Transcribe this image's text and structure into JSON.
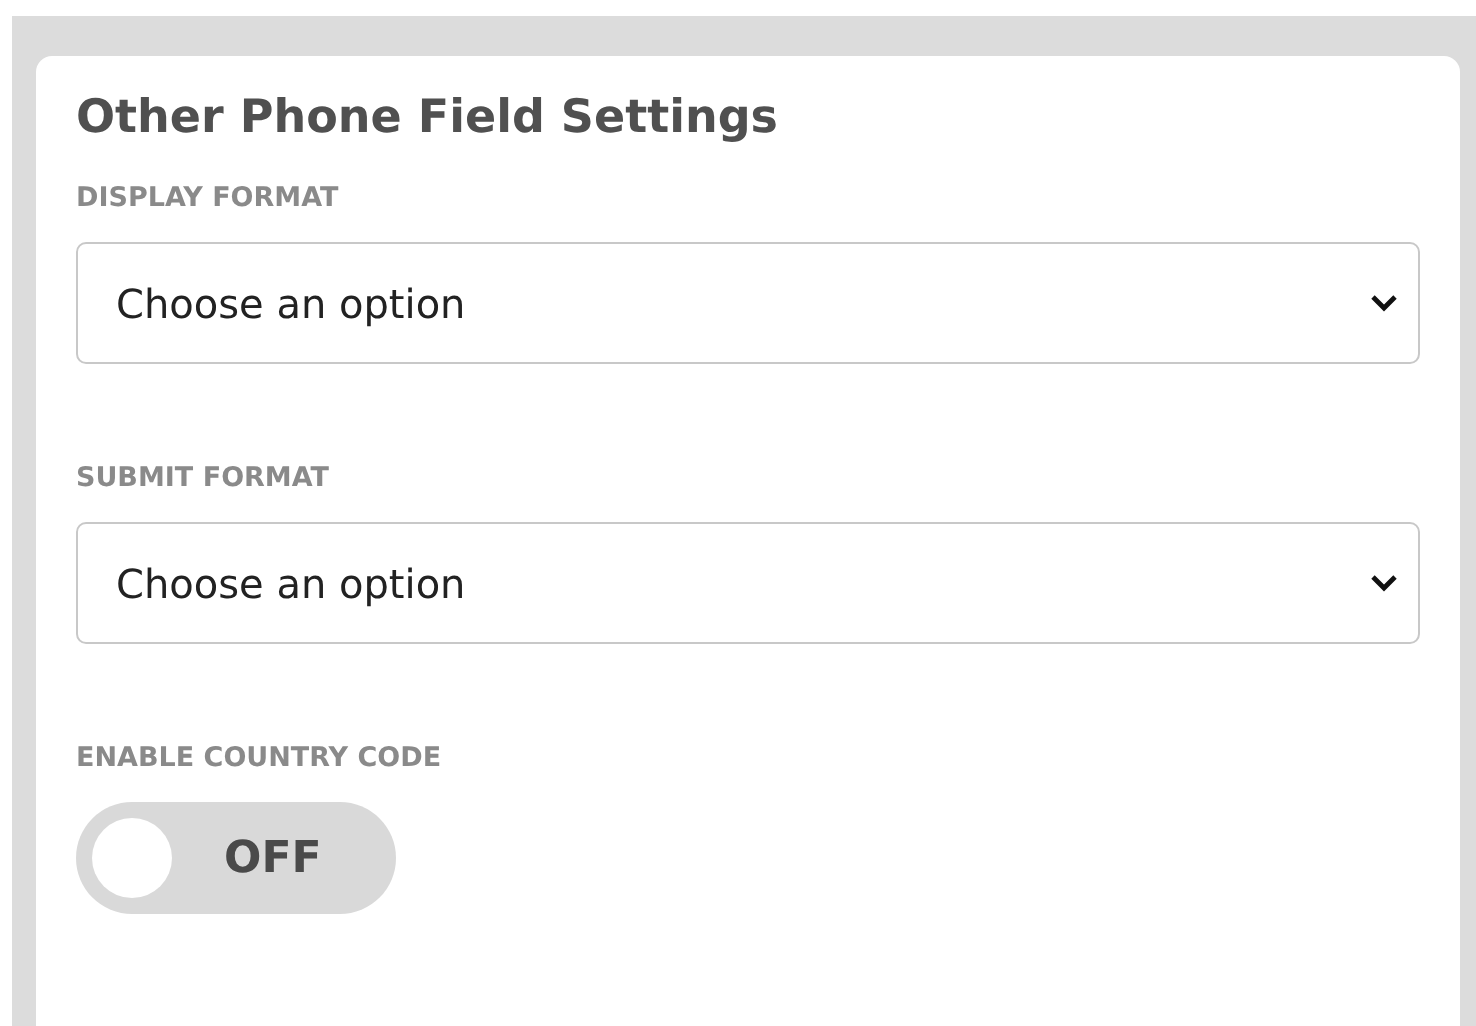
{
  "card": {
    "title": "Other Phone Field Settings"
  },
  "fields": [
    {
      "kind": "select",
      "label": "DISPLAY FORMAT",
      "value": "Choose an option"
    },
    {
      "kind": "select",
      "label": "SUBMIT FORMAT",
      "value": "Choose an option"
    },
    {
      "kind": "toggle",
      "label": "ENABLE COUNTRY CODE",
      "on": false,
      "state_text": "OFF"
    }
  ]
}
